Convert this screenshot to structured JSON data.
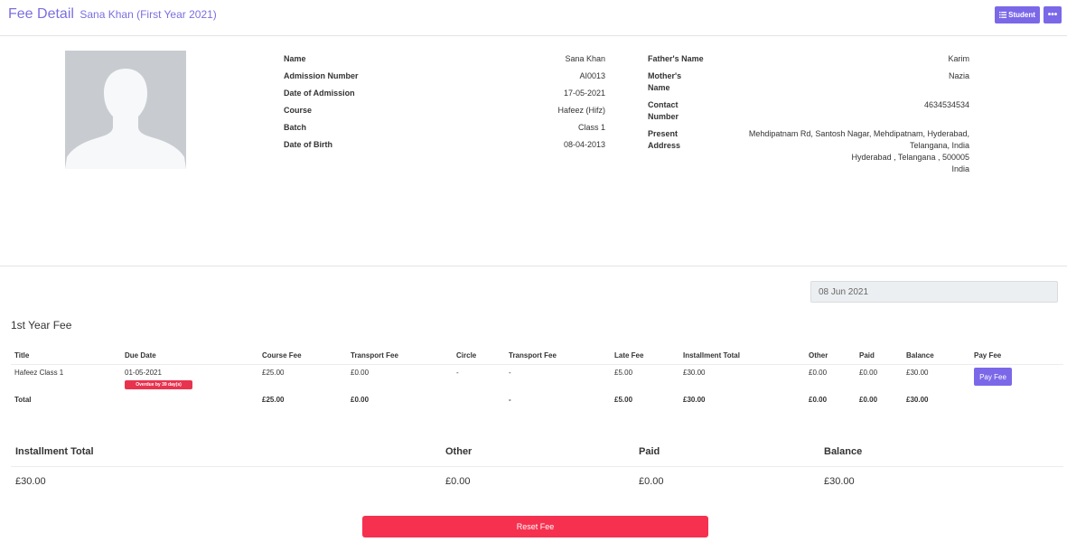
{
  "header": {
    "title": "Fee Detail",
    "subtitle": "Sana Khan (First Year 2021)",
    "student_button_label": "Student",
    "more_button_label": "•••"
  },
  "student": {
    "left": [
      {
        "label": "Name",
        "value": "Sana Khan"
      },
      {
        "label": "Admission Number",
        "value": "AI0013"
      },
      {
        "label": "Date of Admission",
        "value": "17-05-2021"
      },
      {
        "label": "Course",
        "value": "Hafeez (Hifz)"
      },
      {
        "label": "Batch",
        "value": "Class 1"
      },
      {
        "label": "Date of Birth",
        "value": "08-04-2013"
      }
    ],
    "right": {
      "father_label": "Father's Name",
      "father_value": "Karim",
      "mother_label_1": "Mother's",
      "mother_label_2": "Name",
      "mother_value": "Nazia",
      "contact_label_1": "Contact",
      "contact_label_2": "Number",
      "contact_value": "4634534534",
      "address_label_1": "Present",
      "address_label_2": "Address",
      "address_lines": [
        "Mehdipatnam Rd, Santosh Nagar, Mehdipatnam, Hyderabad,",
        "Telangana, India",
        "Hyderabad , Telangana , 500005",
        "India"
      ]
    }
  },
  "date_field": {
    "value": "08 Jun 2021"
  },
  "fee_section": {
    "heading": "1st Year Fee",
    "columns": [
      "Title",
      "Due Date",
      "Course Fee",
      "Transport Fee",
      "Circle",
      "Transport Fee",
      "Late Fee",
      "Installment Total",
      "Other",
      "Paid",
      "Balance",
      "Pay Fee"
    ],
    "row": {
      "title": "Hafeez Class 1",
      "due_date": "01-05-2021",
      "overdue_badge": "Overdue by 39 day(s)",
      "course_fee": "£25.00",
      "transport_fee": "£0.00",
      "circle": "-",
      "transport_fee_2": "-",
      "late_fee": "£5.00",
      "installment_total": "£30.00",
      "other": "£0.00",
      "paid": "£0.00",
      "balance": "£30.00",
      "pay_button": "Pay Fee"
    },
    "total": {
      "label": "Total",
      "course_fee": "£25.00",
      "transport_fee": "£0.00",
      "transport_fee_2": "-",
      "late_fee": "£5.00",
      "installment_total": "£30.00",
      "other": "£0.00",
      "paid": "£0.00",
      "balance": "£30.00"
    }
  },
  "summary": {
    "headers": [
      "Installment Total",
      "Other",
      "Paid",
      "Balance"
    ],
    "values": [
      "£30.00",
      "£0.00",
      "£0.00",
      "£30.00"
    ]
  },
  "reset_button": "Reset Fee",
  "colors": {
    "accent": "#7b68e8",
    "danger": "#f5314f",
    "photo_bg": "#c8ccd1"
  }
}
